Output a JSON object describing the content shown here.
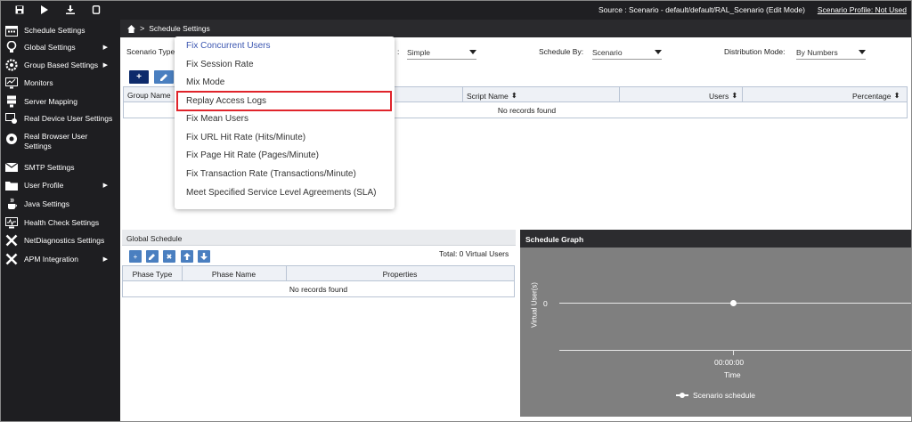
{
  "topbar": {
    "source": "Source : Scenario - default/default/RAL_Scenario (Edit Mode)",
    "profile": "Scenario Profile: Not Used",
    "icons": [
      "save-icon",
      "play-icon",
      "download-icon",
      "mobile-icon"
    ]
  },
  "sidebar": {
    "items": [
      {
        "label": "Schedule Settings",
        "icon": "schedule-icon"
      },
      {
        "label": "Global Settings",
        "icon": "bulb-icon"
      },
      {
        "label": "Group Based Settings",
        "icon": "group-gear-icon"
      },
      {
        "label": "Monitors",
        "icon": "monitor-icon"
      },
      {
        "label": "Server Mapping",
        "icon": "server-icon"
      },
      {
        "label": "Real Device User Settings",
        "icon": "device-settings-icon"
      },
      {
        "label": "Real Browser User Settings",
        "icon": "browser-icon"
      },
      {
        "label": "SMTP Settings",
        "icon": "mail-icon"
      },
      {
        "label": "User Profile",
        "icon": "folder-icon"
      },
      {
        "label": "Java Settings",
        "icon": "java-icon"
      },
      {
        "label": "Health Check Settings",
        "icon": "health-check-icon"
      },
      {
        "label": "NetDiagnostics Settings",
        "icon": "tools-icon"
      },
      {
        "label": "APM Integration",
        "icon": "apm-icon"
      }
    ]
  },
  "breadcrumb": {
    "label": "Schedule Settings"
  },
  "form": {
    "scenario_type_label": "Scenario Type",
    "type_value": "Simple",
    "schedule_by_label": "Schedule By:",
    "schedule_by_value": "Scenario",
    "distribution_label": "Distribution Mode:",
    "distribution_value": "By Numbers"
  },
  "groups_table": {
    "columns": [
      "Group Name",
      "Script Name",
      "Users",
      "Percentage"
    ],
    "empty": "No records found"
  },
  "dropdown": {
    "items": [
      "Fix Concurrent Users",
      "Fix Session Rate",
      "Mix Mode",
      "Replay Access Logs",
      "Fix Mean Users",
      "Fix URL Hit Rate (Hits/Minute)",
      "Fix Page Hit Rate (Pages/Minute)",
      "Fix Transaction Rate (Transactions/Minute)",
      "Meet Specified Service Level Agreements (SLA)"
    ]
  },
  "global_schedule": {
    "title": "Global Schedule",
    "total": "Total: 0 Virtual Users",
    "columns": [
      "Phase Type",
      "Phase Name",
      "Properties"
    ],
    "empty": "No records found"
  },
  "graph": {
    "title": "Schedule Graph",
    "ylabel": "Virtual User(s)",
    "ytick": "0",
    "xtick": "00:00:00",
    "xlabel": "Time",
    "legend": "Scenario schedule"
  },
  "colors": {
    "selected_item": "#3a55b0",
    "highlight_border": "#e0242b",
    "primary_button": "#0d2a6b"
  }
}
